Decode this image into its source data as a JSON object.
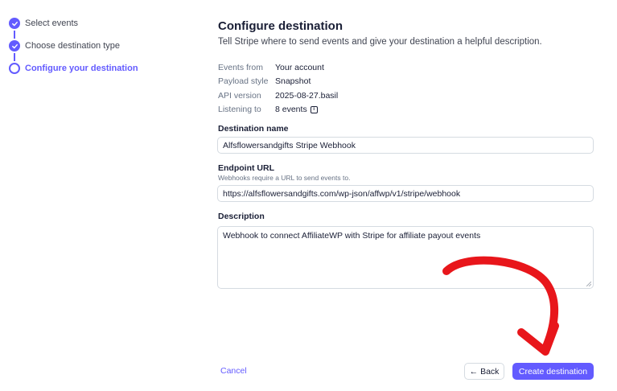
{
  "stepper": {
    "steps": [
      {
        "label": "Select events",
        "state": "done"
      },
      {
        "label": "Choose destination type",
        "state": "done"
      },
      {
        "label": "Configure your destination",
        "state": "current"
      }
    ]
  },
  "header": {
    "title": "Configure destination",
    "subtitle": "Tell Stripe where to send events and give your destination a helpful description."
  },
  "meta": [
    {
      "key": "Events from",
      "value": "Your account"
    },
    {
      "key": "Payload style",
      "value": "Snapshot"
    },
    {
      "key": "API version",
      "value": "2025-08-27.basil"
    },
    {
      "key": "Listening to",
      "value": "8 events"
    }
  ],
  "form": {
    "name": {
      "label": "Destination name",
      "value": "Alfsflowersandgifts Stripe Webhook"
    },
    "url": {
      "label": "Endpoint URL",
      "help": "Webhooks require a URL to send events to.",
      "value": "https://alfsflowersandgifts.com/wp-json/affwp/v1/stripe/webhook"
    },
    "description": {
      "label": "Description",
      "value": "Webhook to connect AffiliateWP with Stripe for affiliate payout events"
    }
  },
  "footer": {
    "cancel_label": "Cancel",
    "back_label": "Back",
    "back_icon": "arrow-left-icon",
    "create_label": "Create destination"
  },
  "colors": {
    "accent": "#635bff",
    "annotation": "#e8161b"
  }
}
